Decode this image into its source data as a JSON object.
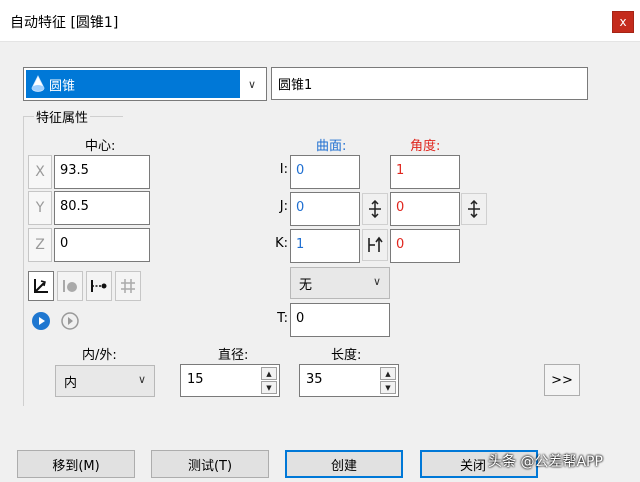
{
  "window": {
    "title": "自动特征 [圆锥1]",
    "close_label": "x"
  },
  "feature": {
    "type": "圆锥",
    "name": "圆锥1"
  },
  "group": {
    "label": "特征属性"
  },
  "headers": {
    "center": "中心:",
    "surface": "曲面:",
    "angle": "角度:"
  },
  "center": {
    "x": {
      "axis": "X",
      "value": "93.5"
    },
    "y": {
      "axis": "Y",
      "value": "80.5"
    },
    "z": {
      "axis": "Z",
      "value": "0"
    }
  },
  "surface": {
    "i": {
      "label": "I:",
      "value": "0"
    },
    "j": {
      "label": "J:",
      "value": "0"
    },
    "k": {
      "label": "K:",
      "value": "1"
    }
  },
  "angle": {
    "i": "1",
    "j": "0",
    "k": "0"
  },
  "dropdown_none": "无",
  "t": {
    "label": "T:",
    "value": "0"
  },
  "inout": {
    "label": "内/外:",
    "value": "内"
  },
  "diameter": {
    "label": "直径:",
    "value": "15"
  },
  "length": {
    "label": "长度:",
    "value": "35"
  },
  "expand_label": ">>",
  "buttons": {
    "move": "移到(M)",
    "test": "测试(T)",
    "create": "创建",
    "close": "关闭"
  },
  "watermark": "头条 @公差帮APP",
  "colors": {
    "accent": "#0078d7",
    "surface_blue": "#1f6fd1",
    "angle_red": "#e0271f"
  }
}
